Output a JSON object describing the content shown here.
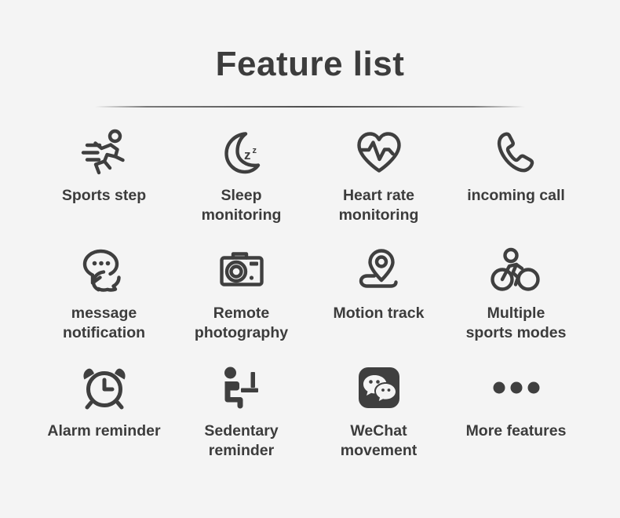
{
  "header": {
    "title": "Feature list"
  },
  "features": [
    {
      "label": "Sports step",
      "icon": "running-person-icon"
    },
    {
      "label": "Sleep\nmonitoring",
      "icon": "crescent-moon-sleep-icon"
    },
    {
      "label": "Heart rate\nmonitoring",
      "icon": "heart-pulse-icon"
    },
    {
      "label": "incoming call",
      "icon": "phone-handset-icon"
    },
    {
      "label": "message\nnotification",
      "icon": "speech-bubbles-icon"
    },
    {
      "label": "Remote\nphotography",
      "icon": "camera-icon"
    },
    {
      "label": "Motion track",
      "icon": "map-pin-route-icon"
    },
    {
      "label": "Multiple\nsports modes",
      "icon": "bicycle-rider-icon"
    },
    {
      "label": "Alarm reminder",
      "icon": "alarm-clock-icon"
    },
    {
      "label": "Sedentary\nreminder",
      "icon": "seated-person-desk-icon"
    },
    {
      "label": "WeChat\nmovement",
      "icon": "wechat-logo-icon"
    },
    {
      "label": "More features",
      "icon": "ellipsis-dots-icon"
    }
  ],
  "colors": {
    "background": "#f4f4f4",
    "text": "#3c3c3c",
    "icon": "#3f3f3f"
  }
}
